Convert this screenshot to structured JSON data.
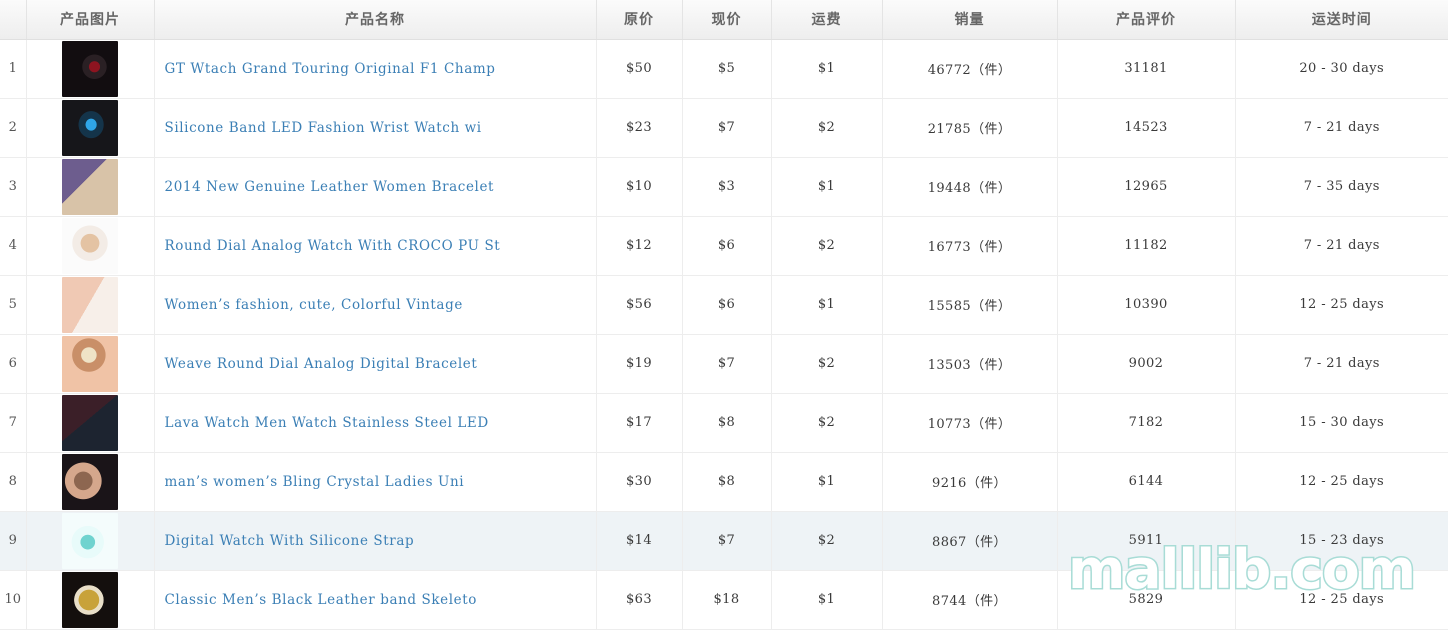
{
  "table": {
    "columns": [
      {
        "key": "index",
        "label": ""
      },
      {
        "key": "image",
        "label": "产品图片"
      },
      {
        "key": "name",
        "label": "产品名称"
      },
      {
        "key": "original",
        "label": "原价"
      },
      {
        "key": "current",
        "label": "现价"
      },
      {
        "key": "shipping",
        "label": "运费"
      },
      {
        "key": "sales",
        "label": "销量"
      },
      {
        "key": "rating",
        "label": "产品评价"
      },
      {
        "key": "delivery",
        "label": "运送时间"
      }
    ],
    "rows": [
      {
        "index": "1",
        "image_name": "product-thumbnail-gt-f1-watch",
        "name": "GT Wtach Grand Touring Original F1 Champ",
        "original": "$50",
        "current": "$5",
        "shipping": "$1",
        "sales": "46772（件）",
        "rating": "31181",
        "delivery": "20 - 30 days",
        "highlight": false
      },
      {
        "index": "2",
        "image_name": "product-thumbnail-silicone-led-watch",
        "name": "Silicone Band LED Fashion Wrist Watch wi",
        "original": "$23",
        "current": "$7",
        "shipping": "$2",
        "sales": "21785（件）",
        "rating": "14523",
        "delivery": "7 - 21 days",
        "highlight": false
      },
      {
        "index": "3",
        "image_name": "product-thumbnail-leather-women-bracelet",
        "name": "2014 New Genuine Leather Women Bracelet",
        "original": "$10",
        "current": "$3",
        "shipping": "$1",
        "sales": "19448（件）",
        "rating": "12965",
        "delivery": "7 - 35 days",
        "highlight": false
      },
      {
        "index": "4",
        "image_name": "product-thumbnail-croco-pu-watch",
        "name": "Round Dial Analog Watch With CROCO PU St",
        "original": "$12",
        "current": "$6",
        "shipping": "$2",
        "sales": "16773（件）",
        "rating": "11182",
        "delivery": "7 - 21 days",
        "highlight": false
      },
      {
        "index": "5",
        "image_name": "product-thumbnail-colorful-vintage-watch",
        "name": "Women’s fashion, cute, Colorful Vintage",
        "original": "$56",
        "current": "$6",
        "shipping": "$1",
        "sales": "15585（件）",
        "rating": "10390",
        "delivery": "12 - 25 days",
        "highlight": false
      },
      {
        "index": "6",
        "image_name": "product-thumbnail-weave-bracelet-watch",
        "name": "Weave Round Dial Analog Digital Bracelet",
        "original": "$19",
        "current": "$7",
        "shipping": "$2",
        "sales": "13503（件）",
        "rating": "9002",
        "delivery": "7 - 21 days",
        "highlight": false
      },
      {
        "index": "7",
        "image_name": "product-thumbnail-lava-steel-led-watch",
        "name": "Lava Watch Men Watch Stainless Steel LED",
        "original": "$17",
        "current": "$8",
        "shipping": "$2",
        "sales": "10773（件）",
        "rating": "7182",
        "delivery": "15 - 30 days",
        "highlight": false
      },
      {
        "index": "8",
        "image_name": "product-thumbnail-bling-crystal-ladies",
        "name": "man’s women’s Bling Crystal Ladies Uni",
        "original": "$30",
        "current": "$8",
        "shipping": "$1",
        "sales": "9216（件）",
        "rating": "6144",
        "delivery": "12 - 25 days",
        "highlight": false
      },
      {
        "index": "9",
        "image_name": "product-thumbnail-digital-silicone-strap",
        "name": "Digital Watch With Silicone Strap",
        "original": "$14",
        "current": "$7",
        "shipping": "$2",
        "sales": "8867（件）",
        "rating": "5911",
        "delivery": "15 - 23 days",
        "highlight": true
      },
      {
        "index": "10",
        "image_name": "product-thumbnail-classic-skeleton-watch",
        "name": "Classic Men’s Black Leather band Skeleto",
        "original": "$63",
        "current": "$18",
        "shipping": "$1",
        "sales": "8744（件）",
        "rating": "5829",
        "delivery": "12 - 25 days",
        "highlight": false
      }
    ]
  },
  "watermark": {
    "text": "malllib.com",
    "outline_color": "#a8dcd6",
    "fill_color": "#ffffff"
  },
  "colors": {
    "link": "#3b7fb5",
    "header_text": "#666666",
    "row_highlight": "#eef3f6",
    "border": "#ededed"
  }
}
